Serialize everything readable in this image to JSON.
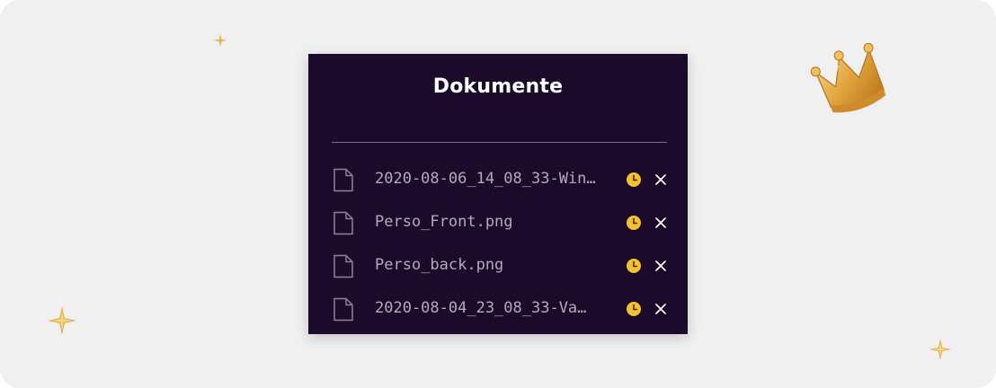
{
  "panel": {
    "title": "Dokumente"
  },
  "files": [
    {
      "name": "2020-08-06_14_08_33-Win…",
      "status_icon": "clock-icon",
      "remove_icon": "close-icon"
    },
    {
      "name": "Perso_Front.png",
      "status_icon": "clock-icon",
      "remove_icon": "close-icon"
    },
    {
      "name": "Perso_back.png",
      "status_icon": "clock-icon",
      "remove_icon": "close-icon"
    },
    {
      "name": "2020-08-04_23_08_33-Va…",
      "status_icon": "clock-icon",
      "remove_icon": "close-icon"
    }
  ],
  "decor": {
    "icons": [
      "sparkle-icon",
      "crown-icon"
    ],
    "sparkle_color": "#e7b24a",
    "crown_color": "#d9972c"
  },
  "colors": {
    "background": "#f0f0f0",
    "panel": "#1b0a29",
    "title": "#ffffff",
    "file_text": "#b3a9c0",
    "pending": "#f2c230",
    "divider": "#7d6e8e"
  }
}
